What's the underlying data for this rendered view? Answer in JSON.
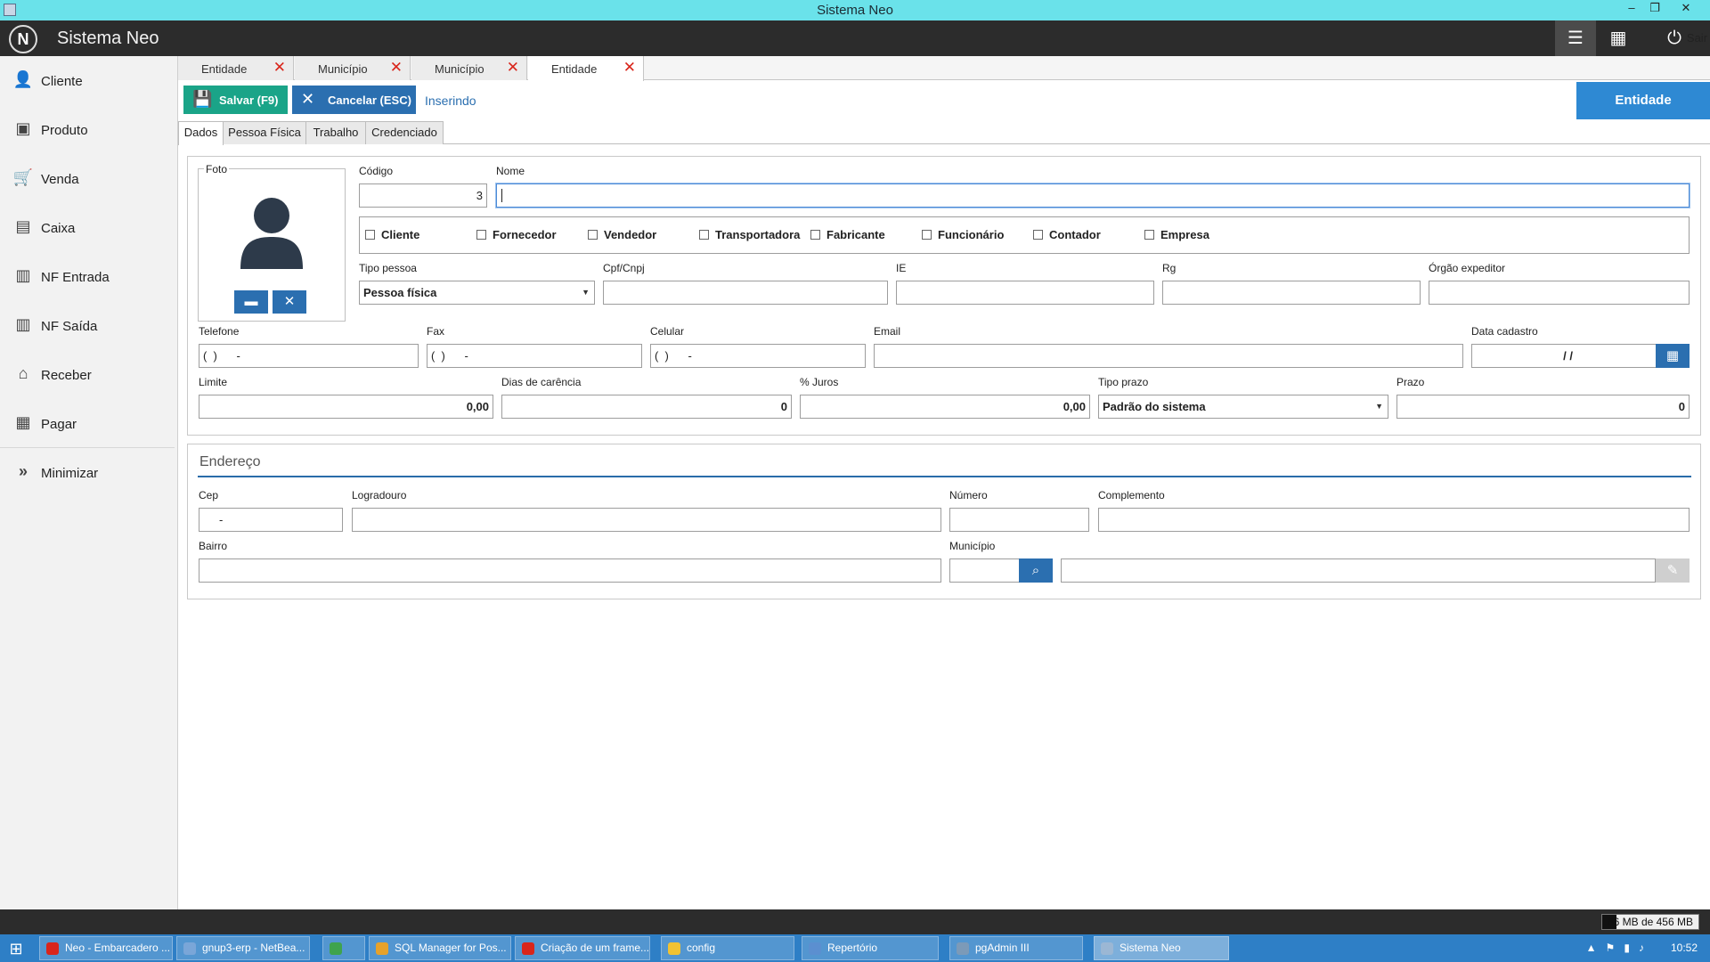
{
  "window": {
    "title": "Sistema Neo",
    "controls": [
      "–",
      "❐",
      "✕"
    ]
  },
  "header": {
    "logo_text": "N",
    "app_name": "Sistema Neo",
    "exit_label": "Sair"
  },
  "sidebar": {
    "items": [
      {
        "label": "Cliente",
        "icon": "user-icon"
      },
      {
        "label": "Produto",
        "icon": "box-icon"
      },
      {
        "label": "Venda",
        "icon": "cart-icon"
      },
      {
        "label": "Caixa",
        "icon": "cash-register-icon"
      },
      {
        "label": "NF Entrada",
        "icon": "document-icon"
      },
      {
        "label": "NF Saída",
        "icon": "document-icon"
      },
      {
        "label": "Receber",
        "icon": "receive-icon"
      },
      {
        "label": "Pagar",
        "icon": "calculator-icon"
      },
      {
        "label": "Minimizar",
        "icon": "double-chevron-icon"
      }
    ]
  },
  "tabs": [
    {
      "label": "Entidade",
      "active": false
    },
    {
      "label": "Município",
      "active": false
    },
    {
      "label": "Município",
      "active": false
    },
    {
      "label": "Entidade",
      "active": true
    }
  ],
  "toolbar": {
    "save_label": "Salvar (F9)",
    "cancel_label": "Cancelar (ESC)",
    "status": "Inserindo",
    "entity": "Entidade"
  },
  "subtabs": [
    "Dados",
    "Pessoa Física",
    "Trabalho",
    "Credenciado"
  ],
  "form": {
    "foto_label": "Foto",
    "codigo_label": "Código",
    "codigo_value": "3",
    "nome_label": "Nome",
    "nome_value": "",
    "checkboxes": [
      "Cliente",
      "Fornecedor",
      "Vendedor",
      "Transportadora",
      "Fabricante",
      "Funcionário",
      "Contador",
      "Empresa"
    ],
    "tipo_pessoa_label": "Tipo pessoa",
    "tipo_pessoa_value": "Pessoa física",
    "cpf_label": "Cpf/Cnpj",
    "ie_label": "IE",
    "rg_label": "Rg",
    "orgao_label": "Órgão expeditor",
    "telefone_label": "Telefone",
    "telefone_mask": "(  )      -",
    "fax_label": "Fax",
    "fax_mask": "(  )      -",
    "celular_label": "Celular",
    "celular_mask": "(  )      -",
    "email_label": "Email",
    "data_cadastro_label": "Data cadastro",
    "data_cadastro_mask": "/  /",
    "limite_label": "Limite",
    "limite_value": "0,00",
    "carencia_label": "Dias de carência",
    "carencia_value": "0",
    "juros_label": "% Juros",
    "juros_value": "0,00",
    "tipo_prazo_label": "Tipo prazo",
    "tipo_prazo_value": "Padrão do sistema",
    "prazo_label": "Prazo",
    "prazo_value": "0"
  },
  "endereco": {
    "title": "Endereço",
    "cep_label": "Cep",
    "cep_mask": "-",
    "logradouro_label": "Logradouro",
    "numero_label": "Número",
    "complemento_label": "Complemento",
    "bairro_label": "Bairro",
    "municipio_label": "Município"
  },
  "statusbar": {
    "memory": "66 MB de 456 MB",
    "memory_fraction": 0.145
  },
  "taskbar": {
    "items": [
      {
        "label": "Neo - Embarcadero ...",
        "color": "#d9251b"
      },
      {
        "label": "gnup3-erp - NetBea...",
        "color": "#7aa6d8"
      },
      {
        "label": "",
        "color": "#3fa34d"
      },
      {
        "label": "SQL Manager for Pos...",
        "color": "#e7a22b"
      },
      {
        "label": "Criação de um frame...",
        "color": "#d9251b"
      },
      {
        "label": "config",
        "color": "#f1c232"
      },
      {
        "label": "Repertório",
        "color": "#5b8fd0"
      },
      {
        "label": "pgAdmin III",
        "color": "#7c9ab8"
      },
      {
        "label": "Sistema Neo",
        "color": "#9bb7d4"
      }
    ],
    "clock": "10:52"
  }
}
